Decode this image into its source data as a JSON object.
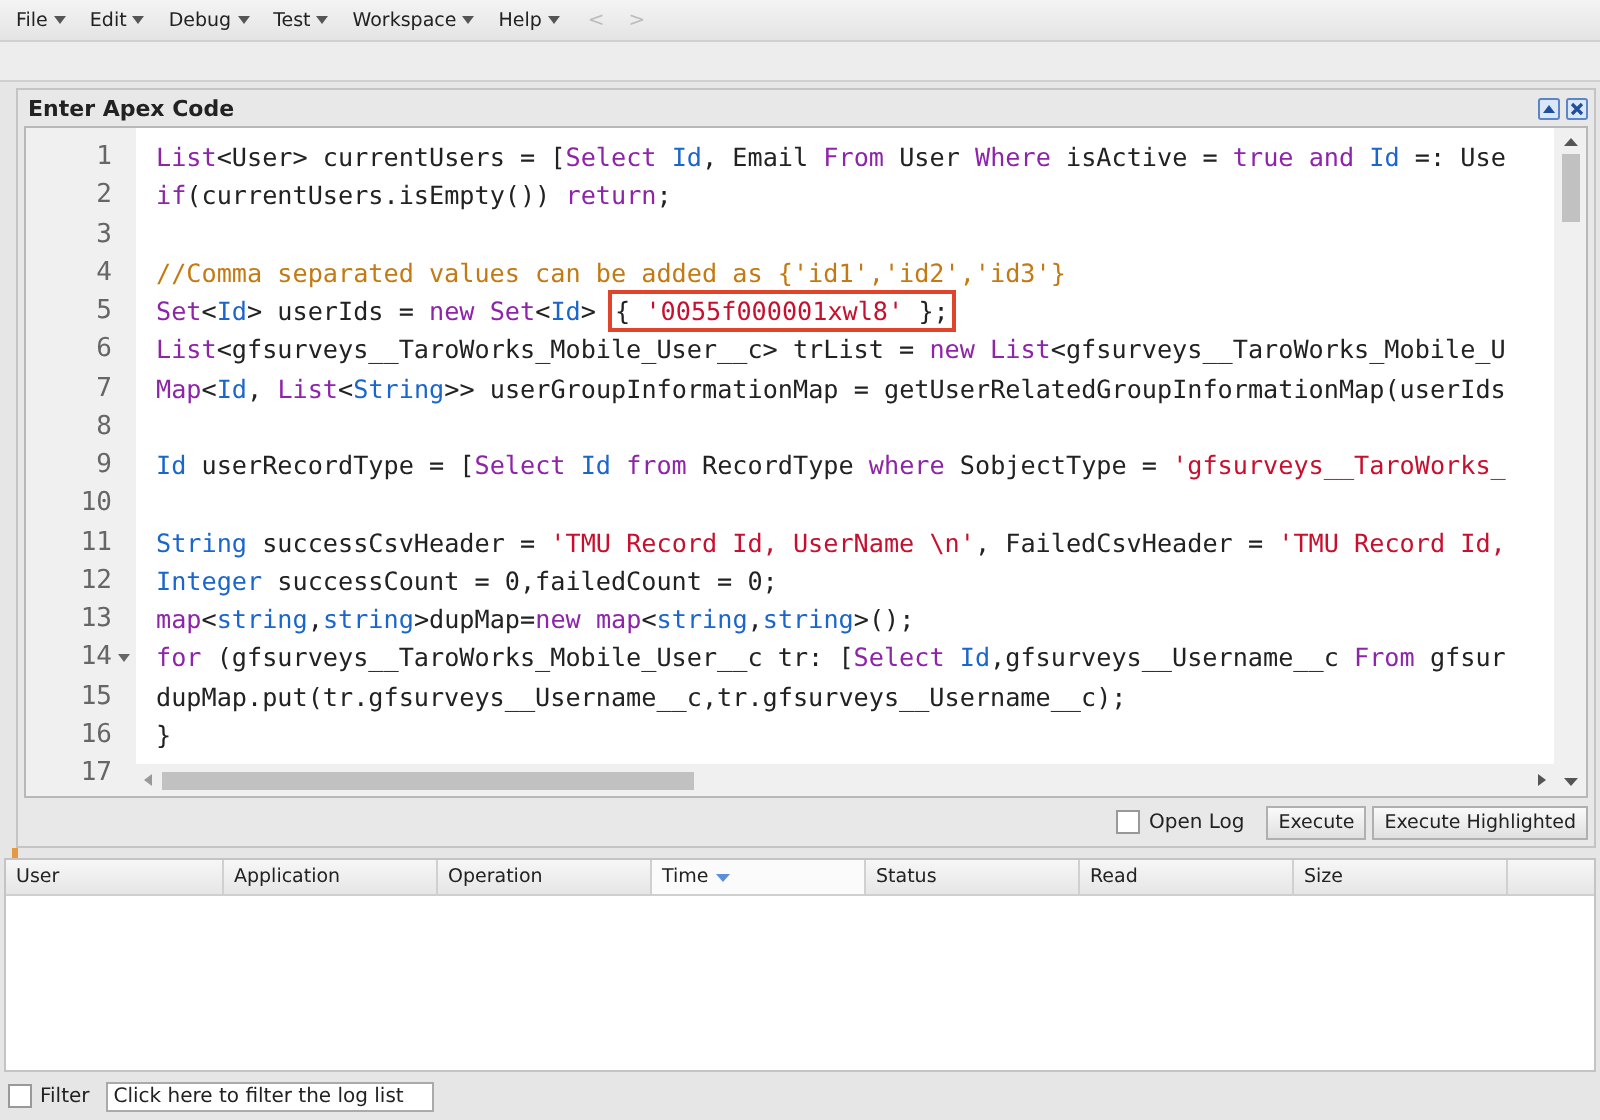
{
  "menu": [
    {
      "label": "File"
    },
    {
      "label": "Edit"
    },
    {
      "label": "Debug"
    },
    {
      "label": "Test"
    },
    {
      "label": "Workspace"
    },
    {
      "label": "Help"
    }
  ],
  "nav": [
    {
      "label": "<",
      "disabled": true
    },
    {
      "label": ">",
      "disabled": true
    }
  ],
  "panel": {
    "title": "Enter Apex Code"
  },
  "code_lines": [
    {
      "number": "1",
      "fold": false,
      "tokens": [
        {
          "kind": "keyword",
          "text": "List"
        },
        {
          "kind": "plain",
          "text": "<User> currentUsers = ["
        },
        {
          "kind": "keyword",
          "text": "Select "
        },
        {
          "kind": "type",
          "text": "Id"
        },
        {
          "kind": "plain",
          "text": ", Email "
        },
        {
          "kind": "keyword",
          "text": "From"
        },
        {
          "kind": "plain",
          "text": " User "
        },
        {
          "kind": "keyword",
          "text": "Where"
        },
        {
          "kind": "plain",
          "text": " isActive = "
        },
        {
          "kind": "keyword",
          "text": "true and "
        },
        {
          "kind": "type",
          "text": "Id"
        },
        {
          "kind": "plain",
          "text": " =: Use"
        }
      ]
    },
    {
      "number": "2",
      "fold": false,
      "tokens": [
        {
          "kind": "keyword",
          "text": "if"
        },
        {
          "kind": "plain",
          "text": "(currentUsers.isEmpty()) "
        },
        {
          "kind": "keyword",
          "text": "return"
        },
        {
          "kind": "plain",
          "text": ";"
        }
      ]
    },
    {
      "number": "3",
      "fold": false
    },
    {
      "number": "4",
      "fold": false,
      "tokens": [
        {
          "kind": "comment",
          "text": "//Comma separated values can be added as {'id1','id2','id3'}"
        }
      ]
    },
    {
      "number": "5",
      "fold": false,
      "tokens": [
        {
          "kind": "keyword",
          "text": "Set"
        },
        {
          "kind": "plain",
          "text": "<"
        },
        {
          "kind": "type",
          "text": "Id"
        },
        {
          "kind": "plain",
          "text": "> userIds = "
        },
        {
          "kind": "keyword",
          "text": "new Set"
        },
        {
          "kind": "plain",
          "text": "<"
        },
        {
          "kind": "type",
          "text": "Id"
        },
        {
          "kind": "plain",
          "text": "> "
        },
        {
          "kind": "box",
          "tokens": [
            {
              "kind": "plain",
              "text": "{ "
            },
            {
              "kind": "string",
              "text": "'0055f000001xwl8'"
            },
            {
              "kind": "plain",
              "text": " };"
            }
          ]
        }
      ]
    },
    {
      "number": "6",
      "fold": false,
      "tokens": [
        {
          "kind": "keyword",
          "text": "List"
        },
        {
          "kind": "plain",
          "text": "<gfsurveys__TaroWorks_Mobile_User__c> trList = "
        },
        {
          "kind": "keyword",
          "text": "new List"
        },
        {
          "kind": "plain",
          "text": "<gfsurveys__TaroWorks_Mobile_U"
        }
      ]
    },
    {
      "number": "7",
      "fold": false,
      "tokens": [
        {
          "kind": "keyword",
          "text": "Map"
        },
        {
          "kind": "plain",
          "text": "<"
        },
        {
          "kind": "type",
          "text": "Id"
        },
        {
          "kind": "plain",
          "text": ", "
        },
        {
          "kind": "keyword",
          "text": "List"
        },
        {
          "kind": "plain",
          "text": "<"
        },
        {
          "kind": "type",
          "text": "String"
        },
        {
          "kind": "plain",
          "text": ">> userGroupInformationMap = getUserRelatedGroupInformationMap(userIds"
        }
      ]
    },
    {
      "number": "8",
      "fold": false
    },
    {
      "number": "9",
      "fold": false,
      "tokens": [
        {
          "kind": "type",
          "text": "Id"
        },
        {
          "kind": "plain",
          "text": " userRecordType = ["
        },
        {
          "kind": "keyword",
          "text": "Select "
        },
        {
          "kind": "type",
          "text": "Id "
        },
        {
          "kind": "keyword",
          "text": "from"
        },
        {
          "kind": "plain",
          "text": " RecordType "
        },
        {
          "kind": "keyword",
          "text": "where"
        },
        {
          "kind": "plain",
          "text": " SobjectType = "
        },
        {
          "kind": "string",
          "text": "'gfsurveys__TaroWorks_"
        }
      ]
    },
    {
      "number": "10",
      "fold": false
    },
    {
      "number": "11",
      "fold": false,
      "tokens": [
        {
          "kind": "type",
          "text": "String"
        },
        {
          "kind": "plain",
          "text": " successCsvHeader = "
        },
        {
          "kind": "string",
          "text": "'TMU Record Id, UserName \\n'"
        },
        {
          "kind": "plain",
          "text": ", FailedCsvHeader = "
        },
        {
          "kind": "string",
          "text": "'TMU Record Id,"
        }
      ]
    },
    {
      "number": "12",
      "fold": false,
      "tokens": [
        {
          "kind": "type",
          "text": "Integer"
        },
        {
          "kind": "plain",
          "text": " successCount = 0,failedCount = 0;"
        }
      ]
    },
    {
      "number": "13",
      "fold": false,
      "tokens": [
        {
          "kind": "keyword",
          "text": "map"
        },
        {
          "kind": "plain",
          "text": "<"
        },
        {
          "kind": "type",
          "text": "string"
        },
        {
          "kind": "plain",
          "text": ","
        },
        {
          "kind": "type",
          "text": "string"
        },
        {
          "kind": "plain",
          "text": ">dupMap="
        },
        {
          "kind": "keyword",
          "text": "new map"
        },
        {
          "kind": "plain",
          "text": "<"
        },
        {
          "kind": "type",
          "text": "string"
        },
        {
          "kind": "plain",
          "text": ","
        },
        {
          "kind": "type",
          "text": "string"
        },
        {
          "kind": "plain",
          "text": ">();"
        }
      ]
    },
    {
      "number": "14",
      "fold": true,
      "tokens": [
        {
          "kind": "keyword",
          "text": "for"
        },
        {
          "kind": "plain",
          "text": " (gfsurveys__TaroWorks_Mobile_User__c tr: ["
        },
        {
          "kind": "keyword",
          "text": "Select "
        },
        {
          "kind": "type",
          "text": "Id"
        },
        {
          "kind": "plain",
          "text": ",gfsurveys__Username__c "
        },
        {
          "kind": "keyword",
          "text": "From"
        },
        {
          "kind": "plain",
          "text": " gfsur"
        }
      ]
    },
    {
      "number": "15",
      "fold": false,
      "tokens": [
        {
          "kind": "plain",
          "text": "dupMap.put(tr.gfsurveys__Username__c,tr.gfsurveys__Username__c);"
        }
      ]
    },
    {
      "number": "16",
      "fold": false,
      "tokens": [
        {
          "kind": "plain",
          "text": "}"
        }
      ]
    },
    {
      "number": "17",
      "fold": false
    }
  ],
  "open_log": {
    "label": "Open Log",
    "checked": false
  },
  "buttons": [
    "Execute",
    "Execute Highlighted"
  ],
  "log_table": {
    "columns": [
      {
        "label": "User",
        "sorted": false
      },
      {
        "label": "Application",
        "sorted": false
      },
      {
        "label": "Operation",
        "sorted": false
      },
      {
        "label": "Time",
        "sorted": true
      },
      {
        "label": "Status",
        "sorted": false
      },
      {
        "label": "Read",
        "sorted": false
      },
      {
        "label": "Size",
        "sorted": false
      }
    ]
  },
  "filter": {
    "label": "Filter",
    "checked": false,
    "placeholder": "Click here to filter the log list"
  }
}
